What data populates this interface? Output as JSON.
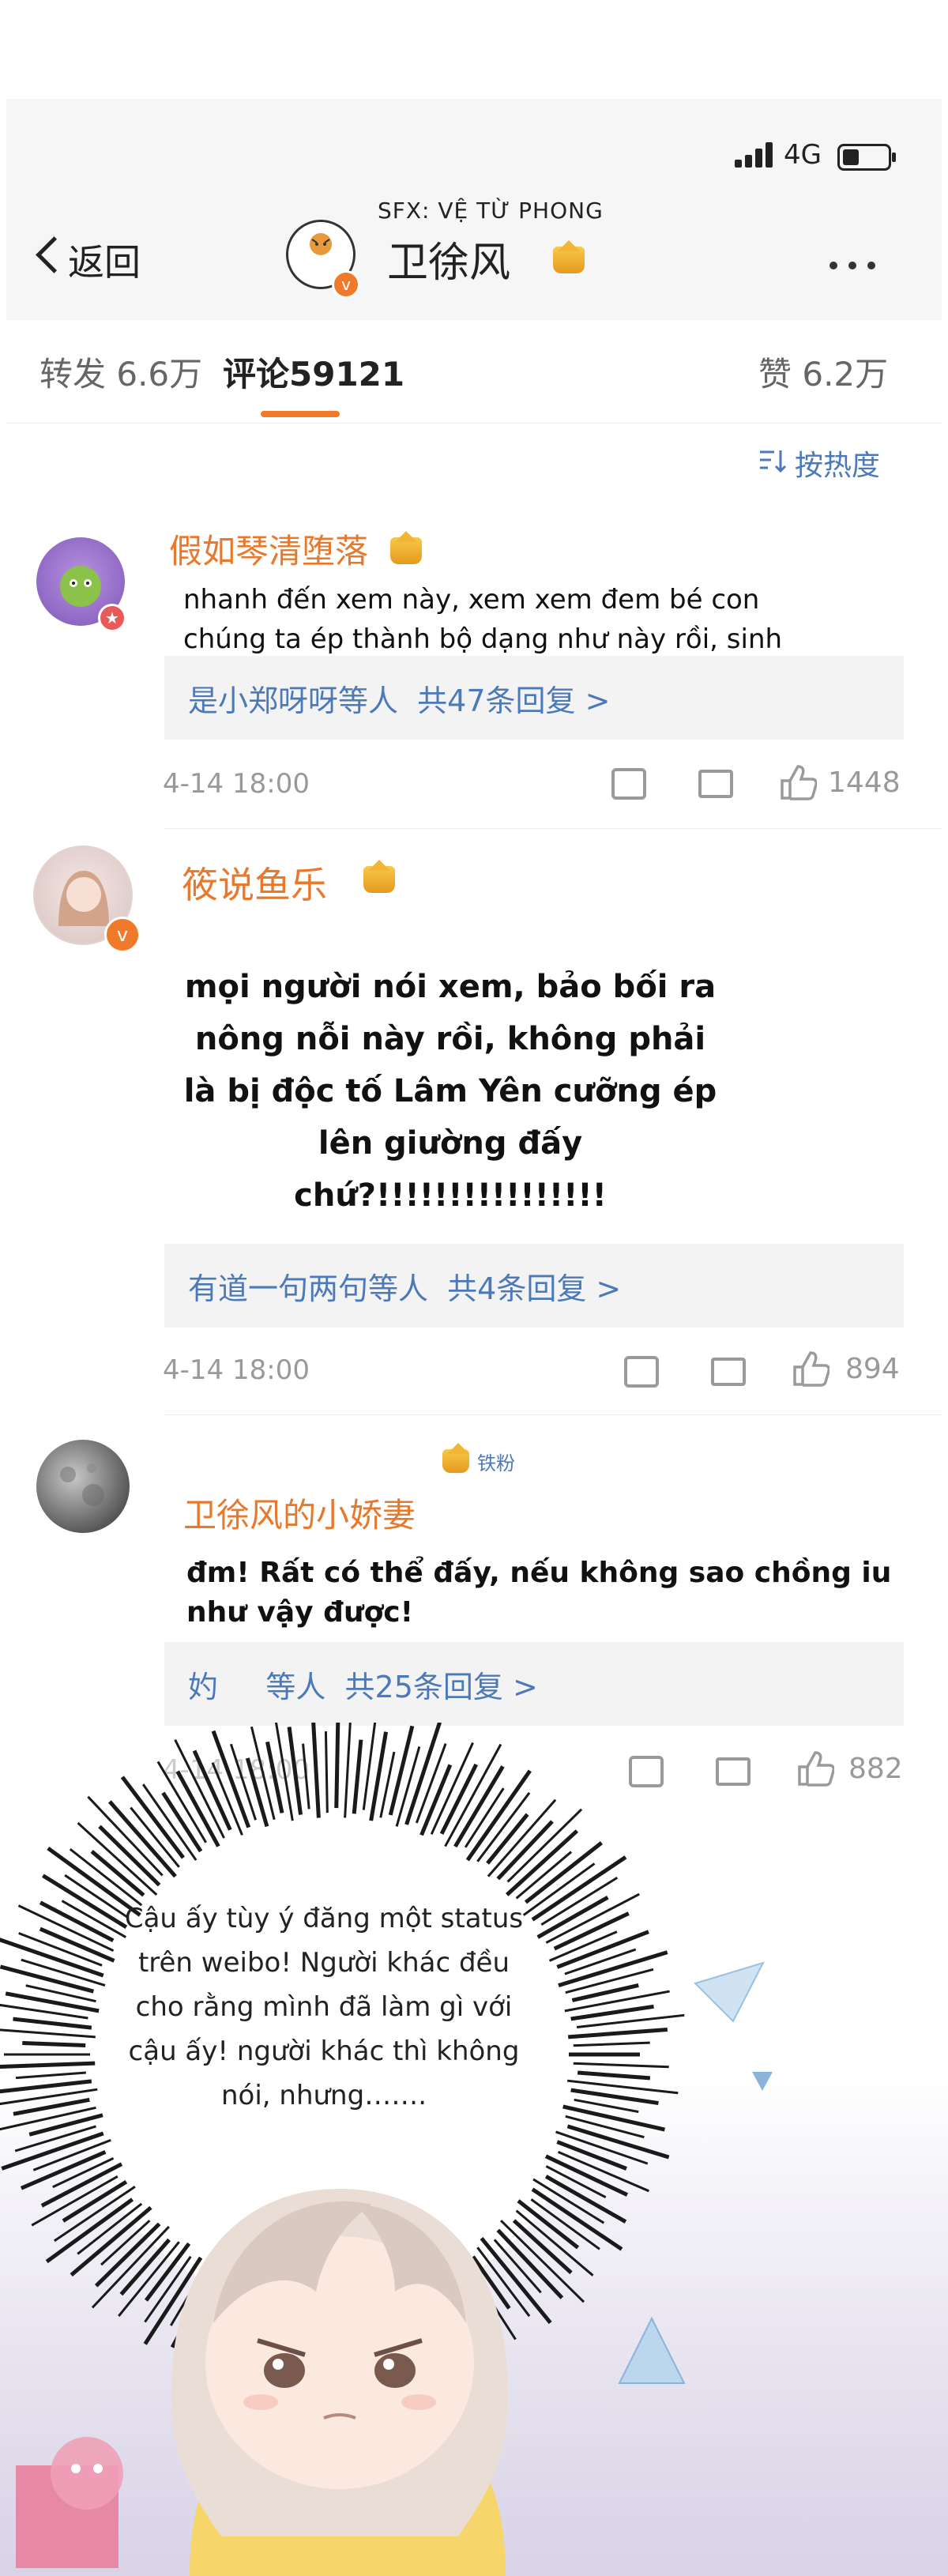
{
  "status_bar": {
    "network": "4G"
  },
  "header": {
    "back_label": "返回",
    "sfx": "SFX: VỆ TỪ PHONG",
    "title": "卫徐风"
  },
  "tabs": {
    "repost": "转发 6.6万",
    "comments_label": "评论",
    "comments_count": "59121",
    "likes": "赞 6.2万"
  },
  "sort_label": "按热度",
  "comments": [
    {
      "username": "假如琴清堕落",
      "text": "nhanh đến xem này, xem xem đem bé con chúng ta ép thành bộ dạng như này rồi, sinh mệnh đều hết phát quang luôn rồi!",
      "replies": "是小郑呀呀等人  共47条回复 >",
      "time": "4-14 18:00",
      "likes": "1448"
    },
    {
      "username": "筱说鱼乐",
      "text": "mọi người nói xem, bảo bối ra nông nỗi này rồi, không phải là bị độc tố Lâm Yên cưỡng ép lên giường đấy chứ?!!!!!!!!!!!!!!!!",
      "replies": "有道一句两句等人  共4条回复 >",
      "time": "4-14 18:00",
      "likes": "894"
    },
    {
      "badge": "铁粉",
      "username": "卫徐风的小娇妻",
      "text": "đm! Rất có thể đấy, nếu không sao chồng iu như vậy được!",
      "replies": "妁     等人  共25条回复 >",
      "time": "4-14 18:00",
      "likes": "882"
    }
  ],
  "narration": "Cậu ấy tùy ý đăng một status trên weibo! Người khác đều cho rằng mình đã làm gì với cậu ấy! người khác thì không nói, nhưng……."
}
